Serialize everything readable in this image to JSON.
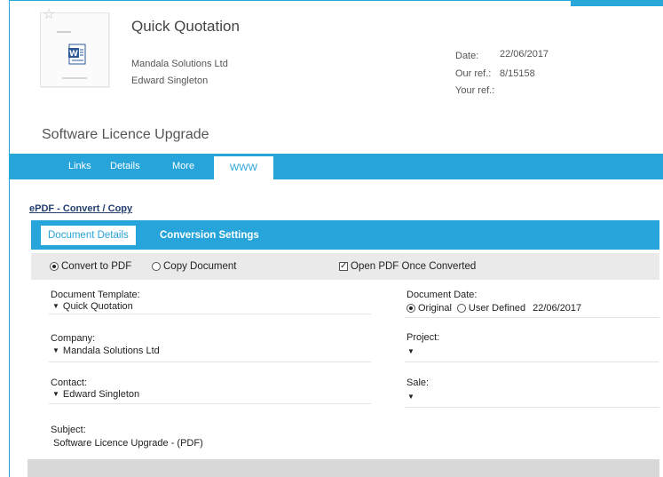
{
  "header": {
    "title": "Quick Quotation",
    "company": "Mandala Solutions Ltd",
    "contact": "Edward Singleton",
    "date_label": "Date:",
    "date_value": "22/06/2017",
    "ourref_label": "Our ref.:",
    "ourref_value": "8/15158",
    "yourref_label": "Your ref.:"
  },
  "section_title": "Software Licence Upgrade",
  "tabs": [
    {
      "label": "Links"
    },
    {
      "label": "Details"
    },
    {
      "label": "More"
    },
    {
      "label": "WWW"
    }
  ],
  "epdf_link": "ePDF - Convert / Copy",
  "inner_tabs": [
    {
      "label": "Document Details"
    },
    {
      "label": "Conversion Settings"
    }
  ],
  "options": {
    "convert_pdf": "Convert to PDF",
    "copy_document": "Copy Document",
    "open_pdf": "Open PDF Once Converted"
  },
  "form": {
    "template_label": "Document Template:",
    "template_value": "Quick Quotation",
    "company_label": "Company:",
    "company_value": "Mandala Solutions Ltd",
    "contact_label": "Contact:",
    "contact_value": "Edward Singleton",
    "subject_label": "Subject:",
    "subject_value": "Software Licence Upgrade - (PDF)",
    "doc_date_label": "Document Date:",
    "original_label": "Original",
    "user_defined_label": "User Defined",
    "doc_date_value": "22/06/2017",
    "project_label": "Project:",
    "sale_label": "Sale:"
  },
  "colors": {
    "accent": "#27a4d9",
    "link": "#233e6f"
  }
}
